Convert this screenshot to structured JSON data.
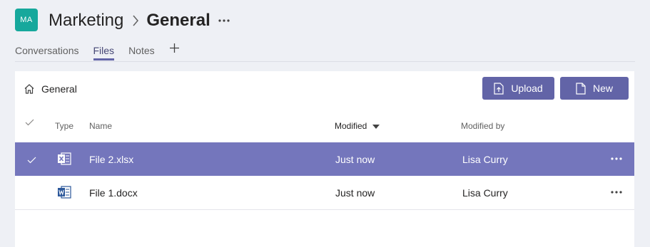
{
  "header": {
    "team_initials": "MA",
    "team_name": "Marketing",
    "channel_name": "General"
  },
  "tabs": [
    {
      "label": "Conversations",
      "active": false
    },
    {
      "label": "Files",
      "active": true
    },
    {
      "label": "Notes",
      "active": false
    }
  ],
  "toolbar": {
    "breadcrumb": "General",
    "upload_label": "Upload",
    "new_label": "New"
  },
  "table": {
    "columns": {
      "type": "Type",
      "name": "Name",
      "modified": "Modified",
      "modified_by": "Modified by"
    },
    "rows": [
      {
        "name": "File 2.xlsx",
        "file_type": "excel-icon",
        "modified": "Just now",
        "modified_by": "Lisa Curry",
        "selected": true
      },
      {
        "name": "File 1.docx",
        "file_type": "word-icon",
        "modified": "Just now",
        "modified_by": "Lisa Curry",
        "selected": false
      }
    ]
  },
  "colors": {
    "accent": "#6264a7",
    "selected_row": "#7476bc",
    "team_avatar": "#16a89c",
    "background": "#eef0f5"
  }
}
